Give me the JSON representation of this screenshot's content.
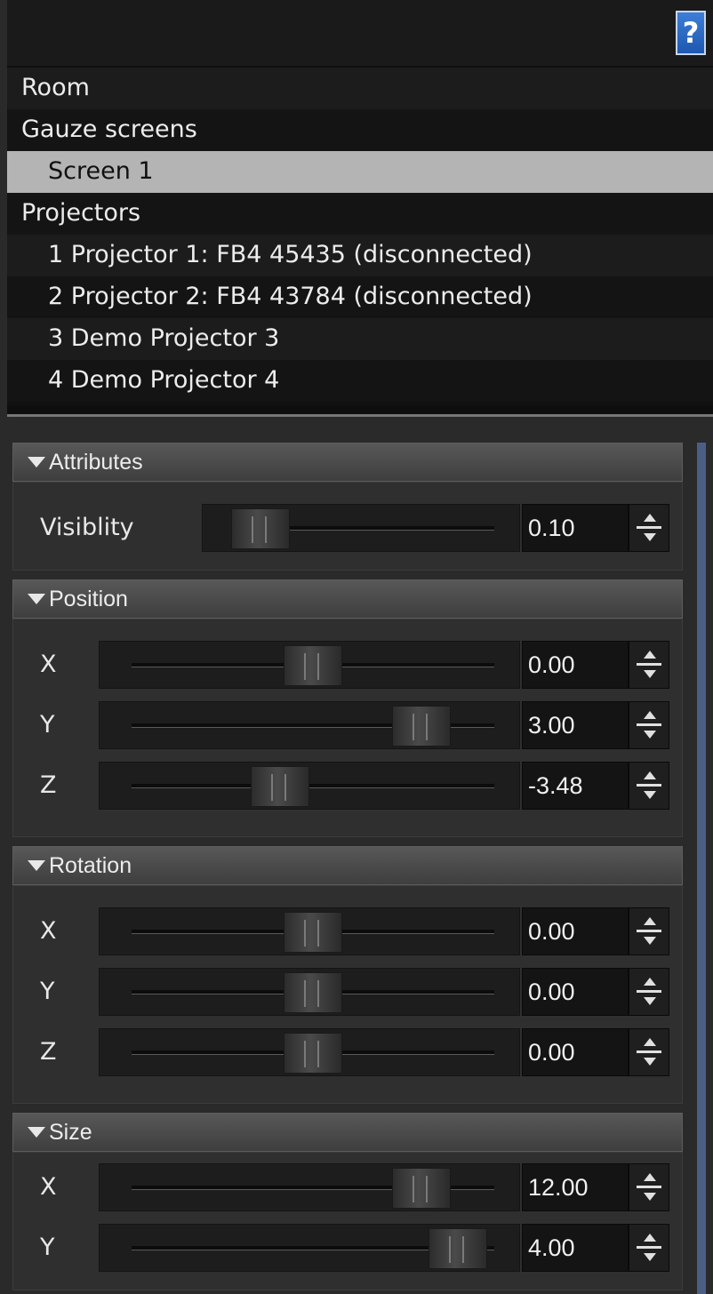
{
  "help_button": {
    "label": "?"
  },
  "tree": {
    "items": [
      {
        "label": "Room",
        "level": 0
      },
      {
        "label": "Gauze screens",
        "level": 0
      },
      {
        "label": "Screen 1",
        "level": 1,
        "selected": true
      },
      {
        "label": "Projectors",
        "level": 0
      },
      {
        "label": "1 Projector 1: FB4 45435 (disconnected)",
        "level": 1
      },
      {
        "label": "2 Projector 2: FB4 43784 (disconnected)",
        "level": 1
      },
      {
        "label": "3 Demo Projector 3",
        "level": 1
      },
      {
        "label": "4 Demo Projector 4",
        "level": 1
      }
    ]
  },
  "sections": [
    {
      "title": "Attributes",
      "rows": [
        {
          "label": "Visiblity",
          "value": "0.10",
          "fraction": 0.1
        }
      ]
    },
    {
      "title": "Position",
      "rows": [
        {
          "label": "X",
          "value": "0.00",
          "fraction": 0.5
        },
        {
          "label": "Y",
          "value": "3.00",
          "fraction": 0.8
        },
        {
          "label": "Z",
          "value": "-3.48",
          "fraction": 0.41
        }
      ]
    },
    {
      "title": "Rotation",
      "rows": [
        {
          "label": "X",
          "value": "0.00",
          "fraction": 0.5
        },
        {
          "label": "Y",
          "value": "0.00",
          "fraction": 0.5
        },
        {
          "label": "Z",
          "value": "0.00",
          "fraction": 0.5
        }
      ]
    },
    {
      "title": "Size",
      "rows": [
        {
          "label": "X",
          "value": "12.00",
          "fraction": 0.8
        },
        {
          "label": "Y",
          "value": "4.00",
          "fraction": 0.9
        }
      ]
    }
  ],
  "colors": {
    "selection": "#b4b4b4",
    "scrollbar": "#4b5f86",
    "help_button": "#2a67c2"
  }
}
